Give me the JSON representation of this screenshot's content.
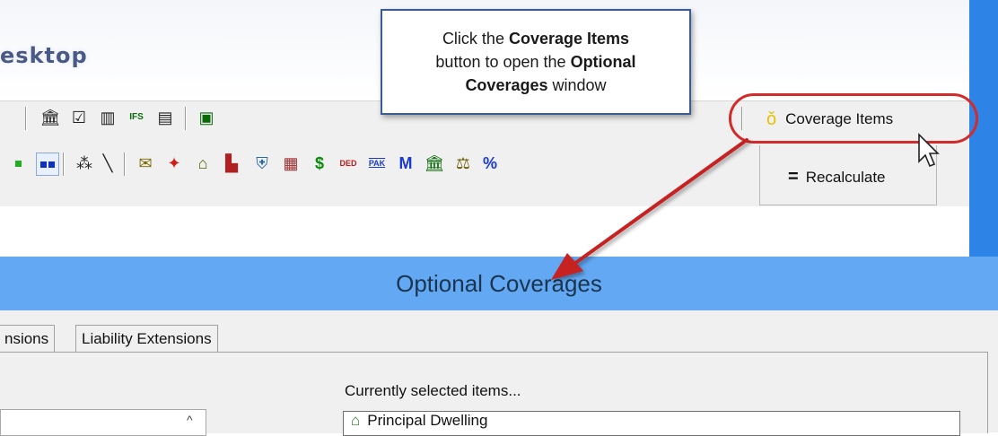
{
  "app": {
    "title_fragment": "esktop"
  },
  "callout": {
    "line1_pre": "Click the ",
    "line1_bold": "Coverage Items",
    "line2_pre": "button to open the ",
    "line2_bold": "Optional",
    "line3_bold": "Coverages",
    "line3_post": " window"
  },
  "toolbar": {
    "coverage_items_label": "Coverage Items",
    "recalculate_label": "Recalculate",
    "icons_row1": [
      "building-icon",
      "clipboard-icon",
      "book-icon",
      "ifs-icon",
      "pdf-icon",
      "dollar-doc-icon"
    ],
    "icons_row2": [
      "green-square-icon",
      "blue-squares-icon",
      "wand-icon",
      "envelope-icon",
      "canada-flag-icon",
      "house-icon",
      "factory-icon",
      "shield-icon",
      "gift-icon",
      "dollar-icon",
      "ded-icon",
      "pak-icon",
      "m-icon",
      "bank-icon",
      "scales-icon",
      "percent-icon"
    ],
    "ded_text": "DED",
    "pak_text": "PAK",
    "m_text": "M",
    "percent_text": "%",
    "dollar_text": "$"
  },
  "dialog": {
    "title": "Optional Coverages",
    "tabs": [
      "nsions",
      "Liability Extensions"
    ],
    "currently_selected_label": "Currently selected items...",
    "selected_items": [
      "Principal Dwelling"
    ]
  },
  "colors": {
    "dialog_title_bg": "#62a8f2",
    "highlight": "#d12b2b",
    "callout_border": "#3a5c92",
    "side_bar": "#2e84e6"
  }
}
